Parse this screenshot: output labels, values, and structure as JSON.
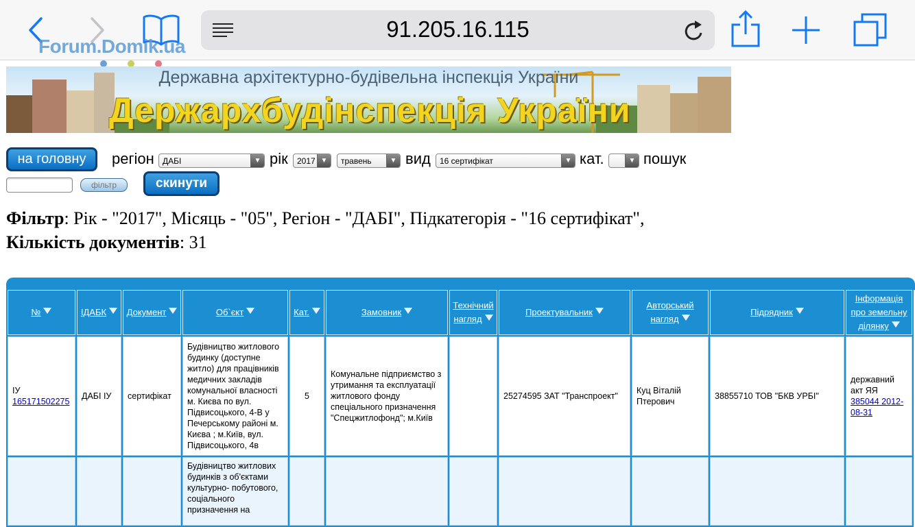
{
  "browser": {
    "url": "91.205.16.115",
    "watermark": "Forum.Domik.ua"
  },
  "banner": {
    "subtitle": "Державна архітектурно-будівельна інспекція України",
    "title": "Держархбудінспекція України"
  },
  "controls": {
    "home_button": "на головну",
    "region_label": "регіон",
    "region_value": "ДАБІ",
    "year_label": "рік",
    "year_value": "2017",
    "month_value": "травень",
    "type_label": "вид",
    "type_value": "16 сертифікат",
    "cat_label": "кат.",
    "cat_value": "",
    "search_label": "пошук",
    "search_value": "",
    "filter_button": "фільтр",
    "reset_button": "скинути"
  },
  "filter": {
    "filter_label": "Фільтр",
    "filter_text": ": Рік - \"2017\", Місяць - \"05\", Регіон - \"ДАБІ\", Підкатегорія - \"16 сертифікат\",",
    "count_label": "Кількість документів",
    "count_text": ": 31"
  },
  "table": {
    "headers": {
      "num": "№",
      "idabk": "ІДАБК",
      "doc": "Документ",
      "object": "Об`єкт",
      "cat": "Кат.",
      "customer": "Замовник",
      "tech": "Технічний нагляд",
      "designer": "Проектувальник",
      "author": "Авторський нагляд",
      "contractor": "Підрядник",
      "land": "Інформація про земельну ділянку"
    },
    "rows": [
      {
        "num_prefix": "ІУ",
        "num_link": "165171502275",
        "idabk": "ДАБІ ІУ",
        "doc": "сертифікат",
        "object": "Будівництво житлового будинку (доступне житло) для працівників медичних закладів комунальної власності м. Києва по вул. Підвисоцького, 4-В у Печерському районі м. Києва ; м.Київ, вул. Підвисоцького, 4в",
        "cat": "5",
        "customer": "Комунальне підприємство з утримання та експлуатації житлового фонду спеціального призначення \"Спецжитлофонд\"; м.Київ",
        "tech": "",
        "designer": "25274595 ЗАТ \"Транспроект\"",
        "author": "Куц Віталій Птерович",
        "contractor": "38855710 ТОВ \"БКВ УРБІ\"",
        "land_text": "державний акт ЯЯ",
        "land_link": "385044 2012-08-31"
      },
      {
        "object": "Будівництво житлових будинків з об'єктами культурно- побутового, соціального призначення на"
      }
    ]
  }
}
